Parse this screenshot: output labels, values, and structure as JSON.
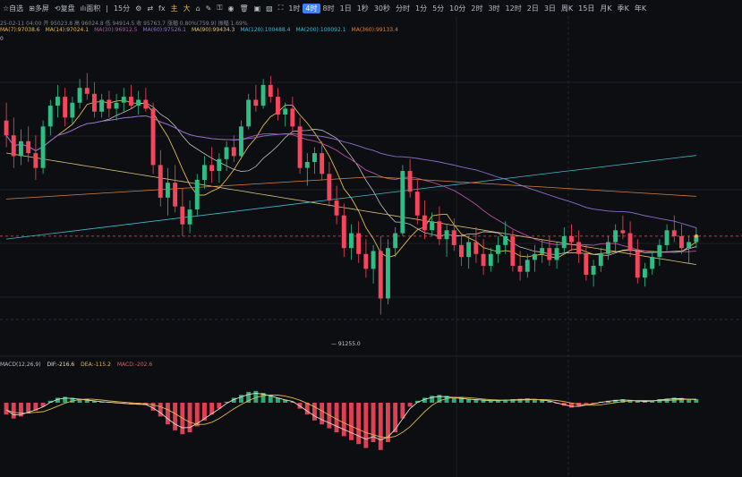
{
  "toolbar": {
    "items": [
      {
        "label": "自选",
        "icon": "star-icon"
      },
      {
        "label": "多屏",
        "icon": "multi-screen-icon"
      },
      {
        "label": "复盘",
        "icon": "replay-icon"
      },
      {
        "label": "面积",
        "icon": "chart-type-icon"
      },
      {
        "label": "15分"
      },
      {
        "label": "1时"
      },
      {
        "label": "4时",
        "active": true
      },
      {
        "label": "8时"
      },
      {
        "label": "1日"
      },
      {
        "label": "1秒"
      },
      {
        "label": "30秒"
      },
      {
        "label": "分时"
      },
      {
        "label": "1分"
      },
      {
        "label": "5分"
      },
      {
        "label": "10分"
      },
      {
        "label": "2时"
      },
      {
        "label": "3时"
      },
      {
        "label": "12时"
      },
      {
        "label": "2日"
      },
      {
        "label": "3日"
      },
      {
        "label": "周K"
      },
      {
        "label": "15日"
      },
      {
        "label": "月K"
      },
      {
        "label": "季K"
      },
      {
        "label": "年K"
      }
    ],
    "icons": [
      "settings-icon",
      "compare-icon",
      "indicator-icon",
      "draw-main-icon",
      "draw-large-icon",
      "magnet-icon",
      "pencil-icon",
      "lock-icon",
      "eye-icon",
      "trash-icon",
      "camera-icon",
      "image-icon",
      "fullscreen-icon"
    ],
    "draw_labels": [
      "主",
      "大"
    ]
  },
  "info_line": "25-02-11 04:00 开 95023.8 高 96024.8 低 94914.5 收 95763.7 涨幅 0.80%(759.9) 振幅 1.69%",
  "ma_lines": [
    {
      "label": "MA(7):97038.6",
      "color": "#e0b84a"
    },
    {
      "label": "MA(14):97024.1",
      "color": "#e0b84a"
    },
    {
      "label": "MA(30):96912.5",
      "color": "#b84fa6"
    },
    {
      "label": "MA(60):97526.1",
      "color": "#8a6fd1"
    },
    {
      "label": "MA(90):99434.3",
      "color": "#d9c07a"
    },
    {
      "label": "MA(120):100488.4",
      "color": "#3fb8c9"
    },
    {
      "label": "MA(200):100092.1",
      "color": "#3fb8c9"
    },
    {
      "label": "MA(360):99133.4",
      "color": "#d9823d"
    }
  ],
  "axis_top": "0",
  "low_price": "91255.0",
  "macd": {
    "title": "MACD(12,26,9)",
    "dif": "DIF:-216.6",
    "dea": "DEA:-115.2",
    "macd": "MACD:-202.6",
    "colors": {
      "dif": "#e6e0c8",
      "dea": "#e0b84a",
      "macd": "#e85a5a"
    }
  },
  "colors": {
    "up": "#2ebd85",
    "down": "#f6465d",
    "bg": "#0d0e11"
  },
  "chart_data": {
    "type": "candlestick",
    "low_label": 91255.0,
    "candles": [
      [
        97800,
        98400,
        96900,
        97300
      ],
      [
        97300,
        97900,
        96200,
        96600
      ],
      [
        96600,
        97500,
        96300,
        97100
      ],
      [
        97100,
        97600,
        96400,
        96700
      ],
      [
        96700,
        97300,
        95800,
        96200
      ],
      [
        96200,
        97800,
        96000,
        97600
      ],
      [
        97600,
        98500,
        97300,
        98300
      ],
      [
        98300,
        99000,
        97900,
        98600
      ],
      [
        98600,
        98900,
        97600,
        97900
      ],
      [
        97900,
        98600,
        97700,
        98400
      ],
      [
        98400,
        99200,
        98200,
        98900
      ],
      [
        98900,
        99400,
        98500,
        98700
      ],
      [
        98700,
        99100,
        97900,
        98100
      ],
      [
        98100,
        98700,
        97900,
        98500
      ],
      [
        98500,
        98800,
        97900,
        98200
      ],
      [
        98200,
        98700,
        97800,
        98400
      ],
      [
        98400,
        98900,
        98100,
        98600
      ],
      [
        98600,
        99000,
        98200,
        98300
      ],
      [
        98300,
        98800,
        98000,
        98500
      ],
      [
        98500,
        98900,
        98100,
        98200
      ],
      [
        98200,
        98400,
        96000,
        96300
      ],
      [
        96300,
        96800,
        94900,
        95200
      ],
      [
        95200,
        96200,
        94600,
        95700
      ],
      [
        95700,
        96300,
        94700,
        94900
      ],
      [
        94900,
        95500,
        93900,
        94300
      ],
      [
        94300,
        95100,
        94000,
        94800
      ],
      [
        94800,
        96000,
        94600,
        95800
      ],
      [
        95800,
        96600,
        95500,
        96300
      ],
      [
        96300,
        96900,
        95700,
        96100
      ],
      [
        96100,
        96700,
        95700,
        96500
      ],
      [
        96500,
        97100,
        96100,
        96900
      ],
      [
        96900,
        97300,
        96400,
        96600
      ],
      [
        96600,
        97800,
        96500,
        97600
      ],
      [
        97600,
        98700,
        97500,
        98500
      ],
      [
        98500,
        99000,
        98100,
        98300
      ],
      [
        98300,
        99200,
        98200,
        99000
      ],
      [
        99000,
        99300,
        98400,
        98600
      ],
      [
        98600,
        98900,
        97800,
        98000
      ],
      [
        98000,
        98400,
        97600,
        98200
      ],
      [
        98200,
        98600,
        97400,
        97600
      ],
      [
        97600,
        97900,
        96000,
        96200
      ],
      [
        96200,
        96700,
        95600,
        96400
      ],
      [
        96400,
        96900,
        96000,
        96700
      ],
      [
        96700,
        97100,
        95800,
        96000
      ],
      [
        96000,
        96400,
        94900,
        95100
      ],
      [
        95100,
        95600,
        94300,
        94600
      ],
      [
        94600,
        95000,
        93200,
        93500
      ],
      [
        93500,
        94300,
        93100,
        94000
      ],
      [
        94000,
        94400,
        93000,
        93300
      ],
      [
        93300,
        93800,
        92500,
        92800
      ],
      [
        92800,
        93600,
        92300,
        93400
      ],
      [
        93400,
        93900,
        91255,
        91800
      ],
      [
        91800,
        93800,
        91600,
        93500
      ],
      [
        93500,
        94200,
        93200,
        94000
      ],
      [
        94000,
        96300,
        93900,
        96100
      ],
      [
        96100,
        96500,
        95200,
        95400
      ],
      [
        95400,
        95800,
        94300,
        94600
      ],
      [
        94600,
        95100,
        93800,
        94100
      ],
      [
        94100,
        94700,
        93900,
        94400
      ],
      [
        94400,
        94900,
        93600,
        93800
      ],
      [
        93800,
        94300,
        93200,
        94100
      ],
      [
        94100,
        94500,
        93400,
        93600
      ],
      [
        93600,
        94000,
        92900,
        93200
      ],
      [
        93200,
        93900,
        92800,
        93700
      ],
      [
        93700,
        94200,
        93000,
        93300
      ],
      [
        93300,
        93800,
        92600,
        92900
      ],
      [
        92900,
        93500,
        92700,
        93300
      ],
      [
        93300,
        93900,
        93000,
        93600
      ],
      [
        93600,
        94400,
        93300,
        93900
      ],
      [
        93900,
        94100,
        92700,
        92900
      ],
      [
        92900,
        93400,
        92400,
        92700
      ],
      [
        92700,
        93300,
        92500,
        93100
      ],
      [
        93100,
        93600,
        92700,
        93300
      ],
      [
        93300,
        93800,
        93000,
        93500
      ],
      [
        93500,
        93900,
        92900,
        93100
      ],
      [
        93100,
        93700,
        92800,
        93500
      ],
      [
        93500,
        94200,
        93300,
        93900
      ],
      [
        93900,
        94300,
        93400,
        93700
      ],
      [
        93700,
        94100,
        93000,
        93300
      ],
      [
        93300,
        93600,
        92400,
        92600
      ],
      [
        92600,
        93100,
        92200,
        92900
      ],
      [
        92900,
        93500,
        92700,
        93300
      ],
      [
        93300,
        93900,
        93100,
        93700
      ],
      [
        93700,
        94300,
        93400,
        94100
      ],
      [
        94100,
        94600,
        93800,
        94000
      ],
      [
        94000,
        94400,
        93200,
        93400
      ],
      [
        93400,
        93800,
        92300,
        92500
      ],
      [
        92500,
        93000,
        92200,
        92800
      ],
      [
        92800,
        93400,
        92600,
        93200
      ],
      [
        93200,
        93800,
        92900,
        93600
      ],
      [
        93600,
        94300,
        93400,
        94100
      ],
      [
        94100,
        94600,
        93700,
        93900
      ],
      [
        93900,
        94300,
        93300,
        93500
      ],
      [
        93500,
        93900,
        93000,
        93700
      ],
      [
        93700,
        94200,
        93500,
        93900
      ]
    ],
    "macd_hist": [
      -60,
      -80,
      -70,
      -55,
      -40,
      -20,
      10,
      25,
      30,
      25,
      20,
      15,
      10,
      5,
      3,
      -2,
      -5,
      -8,
      -10,
      -12,
      -40,
      -70,
      -110,
      -140,
      -160,
      -150,
      -120,
      -90,
      -60,
      -30,
      5,
      25,
      40,
      55,
      60,
      50,
      40,
      25,
      15,
      5,
      -30,
      -60,
      -90,
      -110,
      -130,
      -150,
      -170,
      -190,
      -210,
      -230,
      -200,
      -240,
      -200,
      -150,
      -80,
      -20,
      10,
      25,
      35,
      40,
      35,
      30,
      25,
      20,
      18,
      15,
      12,
      14,
      16,
      18,
      20,
      22,
      20,
      15,
      10,
      -5,
      -15,
      -25,
      -20,
      -12,
      -5,
      5,
      10,
      15,
      18,
      14,
      10,
      8,
      12,
      18,
      22,
      26,
      24,
      20,
      18
    ]
  }
}
